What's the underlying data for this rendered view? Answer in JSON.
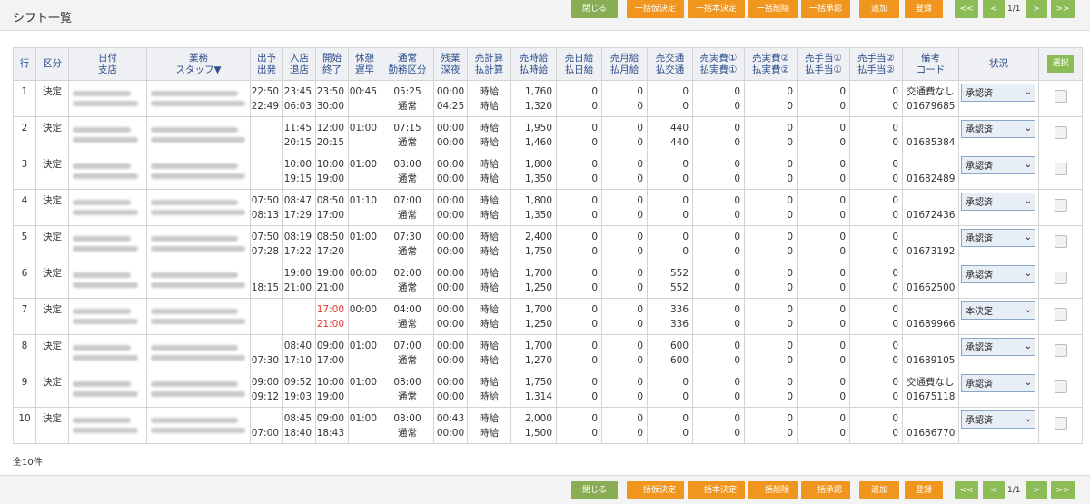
{
  "page": {
    "title": "シフト一覧",
    "total": "全10件"
  },
  "toolbar": {
    "close": "閉じる",
    "bulk_provisional": "一括仮決定",
    "bulk_final": "一括本決定",
    "bulk_delete": "一括削除",
    "bulk_approve": "一括承認",
    "add": "追加",
    "register": "登録",
    "first": "<<",
    "prev": "<",
    "page_info": "1/1",
    "next": ">",
    "last": ">>"
  },
  "table": {
    "headers": [
      [
        "行"
      ],
      [
        "区分"
      ],
      [
        "日付",
        "支店"
      ],
      [
        "業務",
        "スタッフ▼"
      ],
      [
        "出予",
        "出発"
      ],
      [
        "入店",
        "退店"
      ],
      [
        "開始",
        "終了"
      ],
      [
        "休憩",
        "遅早"
      ],
      [
        "通常",
        "勤務区分"
      ],
      [
        "残業",
        "深夜"
      ],
      [
        "売計算",
        "払計算"
      ],
      [
        "売時給",
        "払時給"
      ],
      [
        "売日給",
        "払日給"
      ],
      [
        "売月給",
        "払月給"
      ],
      [
        "売交通",
        "払交通"
      ],
      [
        "売実費①",
        "払実費①"
      ],
      [
        "売実費②",
        "払実費②"
      ],
      [
        "売手当①",
        "払手当①"
      ],
      [
        "売手当②",
        "払手当②"
      ],
      [
        "備考",
        "コード"
      ],
      [
        "状況"
      ]
    ],
    "select_all": "選択",
    "rows": [
      {
        "no": "1",
        "kubun": "決定",
        "dep": [
          "22:50",
          "22:49"
        ],
        "inout": [
          "23:45",
          "06:03"
        ],
        "startend": [
          "23:50",
          "30:00"
        ],
        "rest": [
          "00:45",
          ""
        ],
        "normal": [
          "05:25",
          "通常"
        ],
        "overtime": [
          "00:00",
          "04:25"
        ],
        "calc": [
          "時給",
          "時給"
        ],
        "hourly": [
          "1,760",
          "1,320"
        ],
        "daily": [
          "0",
          "0"
        ],
        "monthly": [
          "0",
          "0"
        ],
        "transport": [
          "0",
          "0"
        ],
        "exp1": [
          "0",
          "0"
        ],
        "exp2": [
          "0",
          "0"
        ],
        "allow1": [
          "0",
          "0"
        ],
        "allow2": [
          "0",
          "0"
        ],
        "note": [
          "交通費なし",
          "01679685"
        ],
        "status": "承認済",
        "red": false
      },
      {
        "no": "2",
        "kubun": "決定",
        "dep": [
          "",
          ""
        ],
        "inout": [
          "11:45",
          "20:15"
        ],
        "startend": [
          "12:00",
          "20:15"
        ],
        "rest": [
          "01:00",
          ""
        ],
        "normal": [
          "07:15",
          "通常"
        ],
        "overtime": [
          "00:00",
          "00:00"
        ],
        "calc": [
          "時給",
          "時給"
        ],
        "hourly": [
          "1,950",
          "1,460"
        ],
        "daily": [
          "0",
          "0"
        ],
        "monthly": [
          "0",
          "0"
        ],
        "transport": [
          "440",
          "440"
        ],
        "exp1": [
          "0",
          "0"
        ],
        "exp2": [
          "0",
          "0"
        ],
        "allow1": [
          "0",
          "0"
        ],
        "allow2": [
          "0",
          "0"
        ],
        "note": [
          "",
          "01685384"
        ],
        "status": "承認済",
        "red": false
      },
      {
        "no": "3",
        "kubun": "決定",
        "dep": [
          "",
          ""
        ],
        "inout": [
          "10:00",
          "19:15"
        ],
        "startend": [
          "10:00",
          "19:00"
        ],
        "rest": [
          "01:00",
          ""
        ],
        "normal": [
          "08:00",
          "通常"
        ],
        "overtime": [
          "00:00",
          "00:00"
        ],
        "calc": [
          "時給",
          "時給"
        ],
        "hourly": [
          "1,800",
          "1,350"
        ],
        "daily": [
          "0",
          "0"
        ],
        "monthly": [
          "0",
          "0"
        ],
        "transport": [
          "0",
          "0"
        ],
        "exp1": [
          "0",
          "0"
        ],
        "exp2": [
          "0",
          "0"
        ],
        "allow1": [
          "0",
          "0"
        ],
        "allow2": [
          "0",
          "0"
        ],
        "note": [
          "",
          "01682489"
        ],
        "status": "承認済",
        "red": false
      },
      {
        "no": "4",
        "kubun": "決定",
        "dep": [
          "07:50",
          "08:13"
        ],
        "inout": [
          "08:47",
          "17:29"
        ],
        "startend": [
          "08:50",
          "17:00"
        ],
        "rest": [
          "01:10",
          ""
        ],
        "normal": [
          "07:00",
          "通常"
        ],
        "overtime": [
          "00:00",
          "00:00"
        ],
        "calc": [
          "時給",
          "時給"
        ],
        "hourly": [
          "1,800",
          "1,350"
        ],
        "daily": [
          "0",
          "0"
        ],
        "monthly": [
          "0",
          "0"
        ],
        "transport": [
          "0",
          "0"
        ],
        "exp1": [
          "0",
          "0"
        ],
        "exp2": [
          "0",
          "0"
        ],
        "allow1": [
          "0",
          "0"
        ],
        "allow2": [
          "0",
          "0"
        ],
        "note": [
          "",
          "01672436"
        ],
        "status": "承認済",
        "red": false
      },
      {
        "no": "5",
        "kubun": "決定",
        "dep": [
          "07:50",
          "07:28"
        ],
        "inout": [
          "08:19",
          "17:22"
        ],
        "startend": [
          "08:50",
          "17:20"
        ],
        "rest": [
          "01:00",
          ""
        ],
        "normal": [
          "07:30",
          "通常"
        ],
        "overtime": [
          "00:00",
          "00:00"
        ],
        "calc": [
          "時給",
          "時給"
        ],
        "hourly": [
          "2,400",
          "1,750"
        ],
        "daily": [
          "0",
          "0"
        ],
        "monthly": [
          "0",
          "0"
        ],
        "transport": [
          "0",
          "0"
        ],
        "exp1": [
          "0",
          "0"
        ],
        "exp2": [
          "0",
          "0"
        ],
        "allow1": [
          "0",
          "0"
        ],
        "allow2": [
          "0",
          "0"
        ],
        "note": [
          "",
          "01673192"
        ],
        "status": "承認済",
        "red": false
      },
      {
        "no": "6",
        "kubun": "決定",
        "dep": [
          "",
          "18:15"
        ],
        "inout": [
          "19:00",
          "21:00"
        ],
        "startend": [
          "19:00",
          "21:00"
        ],
        "rest": [
          "00:00",
          ""
        ],
        "normal": [
          "02:00",
          "通常"
        ],
        "overtime": [
          "00:00",
          "00:00"
        ],
        "calc": [
          "時給",
          "時給"
        ],
        "hourly": [
          "1,700",
          "1,250"
        ],
        "daily": [
          "0",
          "0"
        ],
        "monthly": [
          "0",
          "0"
        ],
        "transport": [
          "552",
          "552"
        ],
        "exp1": [
          "0",
          "0"
        ],
        "exp2": [
          "0",
          "0"
        ],
        "allow1": [
          "0",
          "0"
        ],
        "allow2": [
          "0",
          "0"
        ],
        "note": [
          "",
          "01662500"
        ],
        "status": "承認済",
        "red": false
      },
      {
        "no": "7",
        "kubun": "決定",
        "dep": [
          "",
          ""
        ],
        "inout": [
          "",
          ""
        ],
        "startend": [
          "17:00",
          "21:00"
        ],
        "rest": [
          "00:00",
          ""
        ],
        "normal": [
          "04:00",
          "通常"
        ],
        "overtime": [
          "00:00",
          "00:00"
        ],
        "calc": [
          "時給",
          "時給"
        ],
        "hourly": [
          "1,700",
          "1,250"
        ],
        "daily": [
          "0",
          "0"
        ],
        "monthly": [
          "0",
          "0"
        ],
        "transport": [
          "336",
          "336"
        ],
        "exp1": [
          "0",
          "0"
        ],
        "exp2": [
          "0",
          "0"
        ],
        "allow1": [
          "0",
          "0"
        ],
        "allow2": [
          "0",
          "0"
        ],
        "note": [
          "",
          "01689966"
        ],
        "status": "本決定",
        "red": true
      },
      {
        "no": "8",
        "kubun": "決定",
        "dep": [
          "",
          "07:30"
        ],
        "inout": [
          "08:40",
          "17:10"
        ],
        "startend": [
          "09:00",
          "17:00"
        ],
        "rest": [
          "01:00",
          ""
        ],
        "normal": [
          "07:00",
          "通常"
        ],
        "overtime": [
          "00:00",
          "00:00"
        ],
        "calc": [
          "時給",
          "時給"
        ],
        "hourly": [
          "1,700",
          "1,270"
        ],
        "daily": [
          "0",
          "0"
        ],
        "monthly": [
          "0",
          "0"
        ],
        "transport": [
          "600",
          "600"
        ],
        "exp1": [
          "0",
          "0"
        ],
        "exp2": [
          "0",
          "0"
        ],
        "allow1": [
          "0",
          "0"
        ],
        "allow2": [
          "0",
          "0"
        ],
        "note": [
          "",
          "01689105"
        ],
        "status": "承認済",
        "red": false
      },
      {
        "no": "9",
        "kubun": "決定",
        "dep": [
          "09:00",
          "09:12"
        ],
        "inout": [
          "09:52",
          "19:03"
        ],
        "startend": [
          "10:00",
          "19:00"
        ],
        "rest": [
          "01:00",
          ""
        ],
        "normal": [
          "08:00",
          "通常"
        ],
        "overtime": [
          "00:00",
          "00:00"
        ],
        "calc": [
          "時給",
          "時給"
        ],
        "hourly": [
          "1,750",
          "1,314"
        ],
        "daily": [
          "0",
          "0"
        ],
        "monthly": [
          "0",
          "0"
        ],
        "transport": [
          "0",
          "0"
        ],
        "exp1": [
          "0",
          "0"
        ],
        "exp2": [
          "0",
          "0"
        ],
        "allow1": [
          "0",
          "0"
        ],
        "allow2": [
          "0",
          "0"
        ],
        "note": [
          "交通費なし",
          "01675118"
        ],
        "status": "承認済",
        "red": false
      },
      {
        "no": "10",
        "kubun": "決定",
        "dep": [
          "",
          "07:00"
        ],
        "inout": [
          "08:45",
          "18:40"
        ],
        "startend": [
          "09:00",
          "18:43"
        ],
        "rest": [
          "01:00",
          ""
        ],
        "normal": [
          "08:00",
          "通常"
        ],
        "overtime": [
          "00:43",
          "00:00"
        ],
        "calc": [
          "時給",
          "時給"
        ],
        "hourly": [
          "2,000",
          "1,500"
        ],
        "daily": [
          "0",
          "0"
        ],
        "monthly": [
          "0",
          "0"
        ],
        "transport": [
          "0",
          "0"
        ],
        "exp1": [
          "0",
          "0"
        ],
        "exp2": [
          "0",
          "0"
        ],
        "allow1": [
          "0",
          "0"
        ],
        "allow2": [
          "0",
          "0"
        ],
        "note": [
          "",
          "01686770"
        ],
        "status": "承認済",
        "red": false
      }
    ]
  }
}
